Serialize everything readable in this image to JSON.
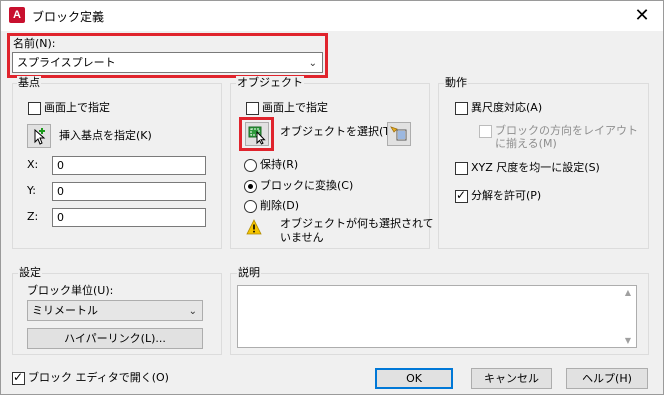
{
  "window": {
    "title": "ブロック定義",
    "close_glyph": "✕",
    "app_icon_letter": "A"
  },
  "name": {
    "label": "名前(N):",
    "value": "スプライスプレート"
  },
  "base_point": {
    "group_label": "基点",
    "specify_on_screen": "画面上で指定",
    "pick_label": "挿入基点を指定(K)",
    "x_label": "X:",
    "x_value": "0",
    "y_label": "Y:",
    "y_value": "0",
    "z_label": "Z:",
    "z_value": "0"
  },
  "objects": {
    "group_label": "オブジェクト",
    "specify_on_screen": "画面上で指定",
    "select_label": "オブジェクトを選択(T)",
    "retain": "保持(R)",
    "convert": "ブロックに変換(C)",
    "delete": "削除(D)",
    "warning_line1": "オブジェクトが何も選択されて",
    "warning_line2": "いません"
  },
  "behavior": {
    "group_label": "動作",
    "annotative": "異尺度対応(A)",
    "match_orientation_line1": "ブロックの方向をレイアウト",
    "match_orientation_line2": "に揃える(M)",
    "uniform_scale": "XYZ 尺度を均一に設定(S)",
    "allow_explode": "分解を許可(P)"
  },
  "settings": {
    "group_label": "設定",
    "unit_label": "ブロック単位(U):",
    "unit_value": "ミリメートル",
    "hyperlink": "ハイパーリンク(L)..."
  },
  "description": {
    "group_label": "説明"
  },
  "footer": {
    "open_in_editor": "ブロック エディタで開く(O)",
    "ok": "OK",
    "cancel": "キャンセル",
    "help": "ヘルプ(H)"
  },
  "colors": {
    "highlight": "#e0242d",
    "accent": "#0078d7",
    "app_icon": "#c8102e"
  }
}
